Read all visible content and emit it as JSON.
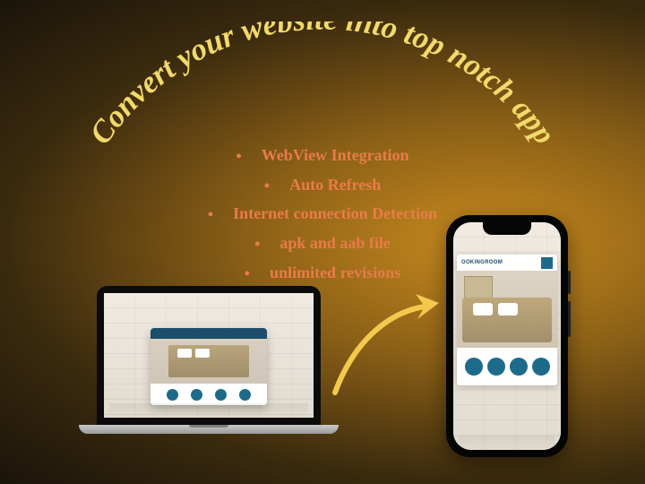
{
  "headline": "Convert your website into top notch app",
  "features": [
    "WebView Integration",
    "Auto Refresh",
    "Internet connection Detection",
    "apk and aab file",
    "unlimited revisions"
  ],
  "phone_site": {
    "brand": "OOKINGROOM"
  }
}
